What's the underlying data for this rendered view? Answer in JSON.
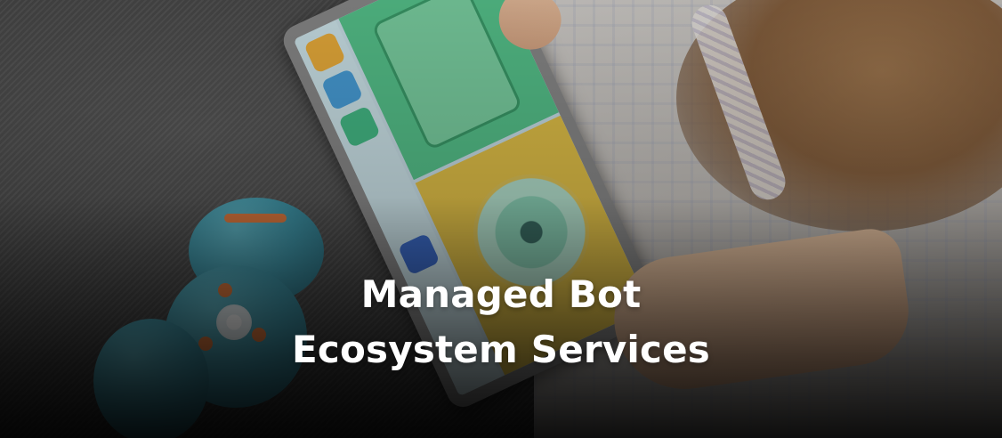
{
  "hero": {
    "title_line1": "Managed Bot",
    "title_line2": "Ecosystem Services"
  },
  "colors": {
    "title_text": "#ffffff",
    "robot_blue": "#3f95a8",
    "robot_accent": "#e07a3f",
    "screen_green": "#58c88f",
    "screen_yellow": "#e9c74a"
  }
}
